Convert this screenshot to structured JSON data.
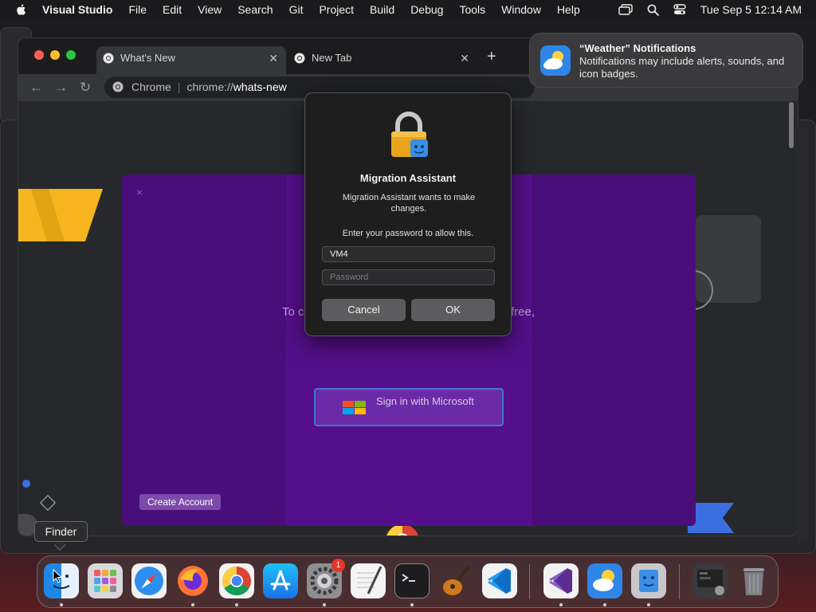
{
  "menubar": {
    "app_name": "Visual Studio",
    "items": [
      "File",
      "Edit",
      "View",
      "Search",
      "Git",
      "Project",
      "Build",
      "Debug",
      "Tools",
      "Window",
      "Help"
    ],
    "clock": "Tue Sep 5  12:14 AM",
    "status_icons": [
      "screen-mirroring-icon",
      "spotlight-search-icon",
      "control-center-icon"
    ]
  },
  "chrome": {
    "tabs": [
      {
        "label": "What's New",
        "icon": "chrome-icon",
        "active": true
      },
      {
        "label": "New Tab",
        "icon": "chrome-icon",
        "active": false
      }
    ],
    "omnibox": {
      "site_label": "Chrome",
      "url_scheme": "chrome://",
      "url_host": "whats-new"
    }
  },
  "purple_modal": {
    "close": "×",
    "text_left": "To c",
    "text_right": "free,",
    "ms_button_label": "Sign in with Microsoft",
    "create_account_label": "Create Account"
  },
  "auth_dialog": {
    "title": "Migration Assistant",
    "message": "Migration Assistant wants to make changes.",
    "prompt": "Enter your password to allow this.",
    "username_value": "VM4",
    "password_placeholder": "Password",
    "cancel_label": "Cancel",
    "ok_label": "OK"
  },
  "notification": {
    "title": "“Weather” Notifications",
    "body": "Notifications may include alerts, sounds, and icon badges."
  },
  "tooltip": {
    "label": "Finder"
  },
  "dock": {
    "apps": [
      "Finder",
      "Launchpad",
      "Safari",
      "Firefox",
      "Google Chrome",
      "App Store",
      "System Settings",
      "TextEdit",
      "Terminal",
      "GarageBand",
      "Visual Studio Code",
      "Visual Studio",
      "Weather",
      "Migration Assistant",
      "Downloads",
      "Trash"
    ],
    "system_settings_badge": "1"
  }
}
